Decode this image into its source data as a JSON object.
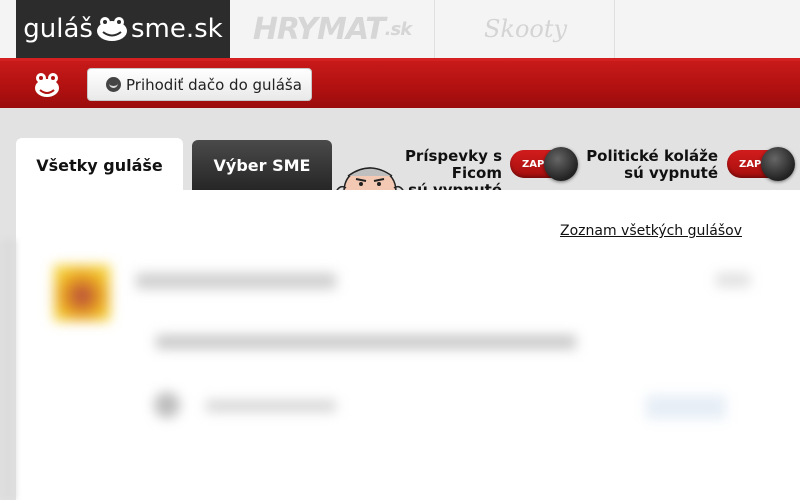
{
  "top_tabs": {
    "gulas": {
      "left": "guláš",
      "right": "sme.sk"
    },
    "hrymat": {
      "main": "HRYMAT",
      "suffix": ".sk"
    },
    "skooty": {
      "label": "Skooty"
    }
  },
  "toolbar": {
    "add_label": "Prihodiť dačo do guláša"
  },
  "tabs": [
    {
      "label": "Všetky guláše",
      "active": true
    },
    {
      "label": "Výber SME",
      "active": false
    }
  ],
  "toggles": [
    {
      "line1": "Príspevky s Ficom",
      "line2": "sú vypnuté",
      "switch_label": "ZAP"
    },
    {
      "line1": "Politické koláže",
      "line2": "sú vypnuté",
      "switch_label": "ZAP"
    }
  ],
  "panel": {
    "all_link": "Zoznam všetkých gulášov"
  },
  "colors": {
    "red_bar": "#b01010",
    "dark_tab": "#2c2c2c",
    "switch": "#c41818"
  },
  "icons": [
    "frog-logo-icon",
    "frog-mascot-icon",
    "smile-icon",
    "fico-cartoon-icon",
    "switch-knob-icon"
  ]
}
